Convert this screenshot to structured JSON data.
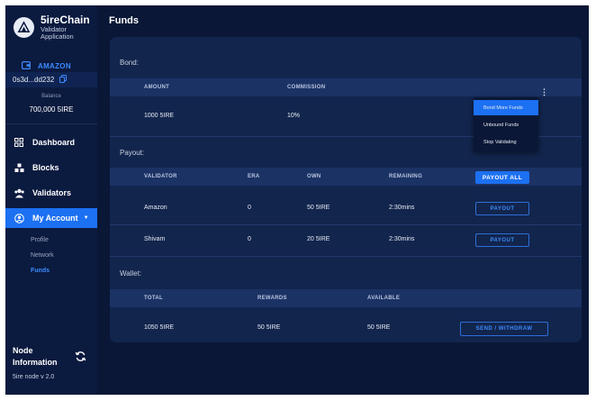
{
  "brand": {
    "name": "5ireChain",
    "subtitle_line1": "Validator",
    "subtitle_line2": "Application"
  },
  "account": {
    "name": "AMAZON",
    "address": "0s3d...dd232",
    "balance_label": "Balance",
    "balance_value": "700,000 5IRE"
  },
  "nav": {
    "items": [
      {
        "label": "Dashboard",
        "icon": "dashboard-icon"
      },
      {
        "label": "Blocks",
        "icon": "blocks-icon"
      },
      {
        "label": "Validators",
        "icon": "validators-icon"
      },
      {
        "label": "My Account",
        "icon": "account-icon",
        "active": true
      }
    ],
    "sub_items": [
      {
        "label": "Profile"
      },
      {
        "label": "Network"
      },
      {
        "label": "Funds",
        "active": true
      }
    ]
  },
  "node": {
    "title_line1": "Node",
    "title_line2": "Information",
    "version": "5ire node v 2.0"
  },
  "page": {
    "title": "Funds"
  },
  "bond": {
    "label": "Bond:",
    "headers": [
      "AMOUNT",
      "COMMISSION"
    ],
    "row": [
      "1000 5IRE",
      "10%"
    ],
    "menu": [
      "Bond More Funds",
      "Unbound Funds",
      "Stop Validating"
    ]
  },
  "payout": {
    "label": "Payout:",
    "headers": [
      "VALIDATOR",
      "ERA",
      "OWN",
      "REMAINING"
    ],
    "payout_all_label": "PAYOUT ALL",
    "payout_label": "PAYOUT",
    "rows": [
      [
        "Amazon",
        "0",
        "50 5IRE",
        "2:30mins"
      ],
      [
        "Shivam",
        "0",
        "20 5IRE",
        "2:30mins"
      ]
    ]
  },
  "wallet": {
    "label": "Wallet:",
    "headers": [
      "TOTAL",
      "REWARDS",
      "AVAILABLE"
    ],
    "row": [
      "1050 5IRE",
      "50 5IRE",
      "50 5IRE"
    ],
    "send_label": "SEND / WITHDRAW"
  },
  "colors": {
    "background": "#0a1736",
    "panel": "#12254d",
    "accent": "#1c70f2",
    "header_row": "#1b3265"
  }
}
